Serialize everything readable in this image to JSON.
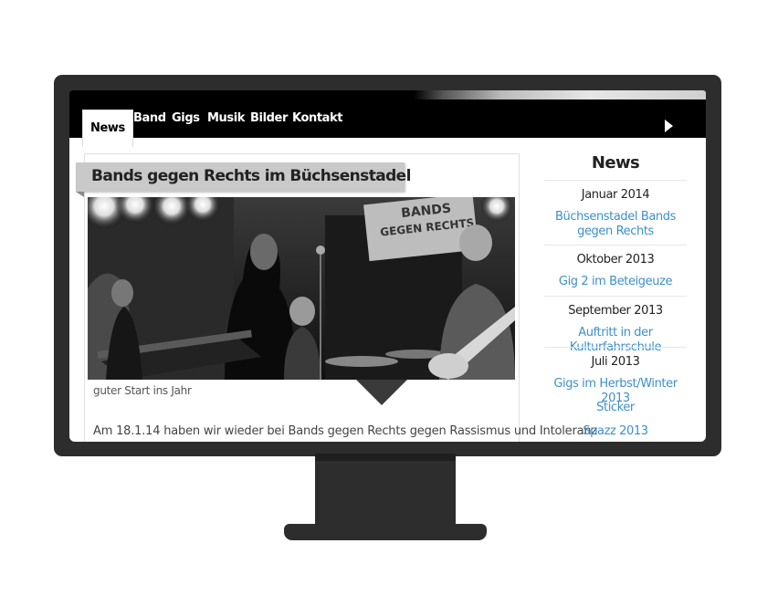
{
  "nav": {
    "items": [
      "News",
      "Band",
      "Gigs",
      "Musik",
      "Bilder",
      "Kontakt"
    ],
    "active": "News"
  },
  "article": {
    "title": "Bands gegen Rechts im Büchsenstadel",
    "banner_line1": "BANDS",
    "banner_line2": "GEGEN RECHTS",
    "caption": "guter Start ins Jahr",
    "body": "Am 18.1.14 haben wir wieder bei Bands gegen Rechts gegen Rassismus und Intoleranz"
  },
  "sidebar": {
    "title": "News",
    "entries": [
      {
        "month": "Januar 2014",
        "link": "Büchsenstadel Bands gegen Rechts"
      },
      {
        "month": "Oktober 2013",
        "link": "Gig 2 im Beteigeuze"
      },
      {
        "month": "September 2013",
        "link": "Auftritt in der Kulturfahrschule"
      },
      {
        "month": "Juli 2013",
        "link": "Gigs im Herbst/Winter 2013"
      }
    ],
    "extra_links": [
      "Sticker",
      "Spazz 2013"
    ]
  },
  "colors": {
    "link": "#3d8fc7",
    "nav_bg": "#000000",
    "monitor": "#2d2d2d",
    "title_bar": "#c9c9c9"
  }
}
